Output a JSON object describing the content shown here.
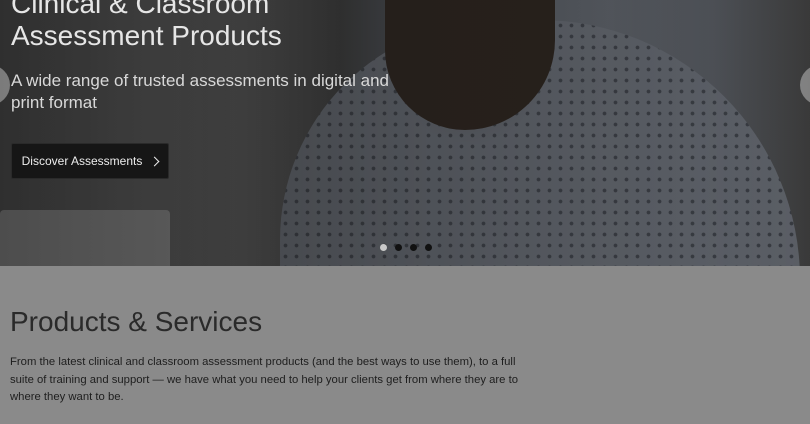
{
  "hero": {
    "title": "Clinical & Classroom Assessment Products",
    "subtitle": "A wide range of trusted assessments in digital and print format",
    "cta_label": "Discover Assessments",
    "carousel": {
      "slide_count": 4,
      "active_index": 0
    }
  },
  "section": {
    "title": "Products & Services",
    "body": "From the latest clinical and classroom assessment products (and the best ways to use them), to a full suite of training and support — we have what you need to help your clients get from where they are to where they want to be."
  },
  "colors": {
    "cta_background": "#161616",
    "page_background": "#8a8a8a"
  },
  "icons": {
    "cta": "chevron-right-icon",
    "carousel_prev": "carousel-prev-arrow",
    "carousel_next": "carousel-next-arrow"
  }
}
